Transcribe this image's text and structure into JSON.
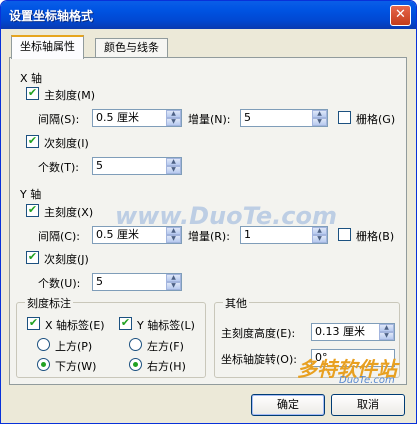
{
  "window": {
    "title": "设置坐标轴格式",
    "close_glyph": "✕"
  },
  "tabs": [
    {
      "label": "坐标轴属性",
      "active": true
    },
    {
      "label": "颜色与线条",
      "active": false
    }
  ],
  "x_axis": {
    "heading": "X 轴",
    "major_tick": {
      "label": "主刻度(M)",
      "checked": true
    },
    "interval": {
      "label": "间隔(S):",
      "value": "0.5 厘米"
    },
    "increment": {
      "label": "增量(N):",
      "value": "5"
    },
    "grid": {
      "label": "栅格(G)",
      "checked": false
    },
    "minor_tick": {
      "label": "次刻度(I)",
      "checked": true
    },
    "count": {
      "label": "个数(T):",
      "value": "5"
    }
  },
  "y_axis": {
    "heading": "Y 轴",
    "major_tick": {
      "label": "主刻度(X)",
      "checked": true
    },
    "interval": {
      "label": "间隔(C):",
      "value": "0.5 厘米"
    },
    "increment": {
      "label": "增量(R):",
      "value": "1"
    },
    "grid": {
      "label": "栅格(B)",
      "checked": false
    },
    "minor_tick": {
      "label": "次刻度(J)",
      "checked": true
    },
    "count": {
      "label": "个数(U):",
      "value": "5"
    }
  },
  "tick_labels": {
    "heading": "刻度标注",
    "x_label": {
      "label": "X 轴标签(E)",
      "checked": true
    },
    "y_label": {
      "label": "Y 轴标签(L)",
      "checked": true
    },
    "top": {
      "label": "上方(P)",
      "selected": false
    },
    "bottom": {
      "label": "下方(W)",
      "selected": true
    },
    "left": {
      "label": "左方(F)",
      "selected": false
    },
    "right": {
      "label": "右方(H)",
      "selected": true
    }
  },
  "other": {
    "heading": "其他",
    "tick_height": {
      "label": "主刻度高度(E):",
      "value": "0.13 厘米"
    },
    "rotation": {
      "label": "坐标轴旋转(O):",
      "value": "0°"
    }
  },
  "buttons": {
    "ok": "确定",
    "cancel": "取消"
  },
  "watermark": {
    "center": "www.DuoTe.com",
    "corner": "多特软件站",
    "corner_sub": "DuoTe.com"
  },
  "colors": {
    "titlebar": "#0054e3",
    "tab_accent": "#e6a51f",
    "check": "#21a121",
    "watermark": "#5a8ad0"
  }
}
